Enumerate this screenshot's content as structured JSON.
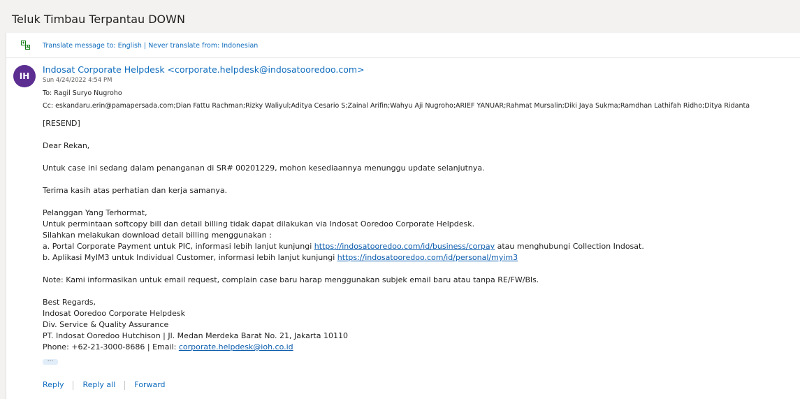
{
  "subject": "Teluk Timbau Terpantau DOWN",
  "translate": {
    "translate_label": "Translate message to: English",
    "separator": " | ",
    "never_label": "Never translate from: Indonesian"
  },
  "message": {
    "avatar_initials": "IH",
    "avatar_color": "#5c2e91",
    "sender": "Indosat Corporate Helpdesk <corporate.helpdesk@indosatooredoo.com>",
    "datetime": "Sun 4/24/2022 4:54 PM",
    "to_line": "To:  Ragil Suryo Nugroho",
    "cc_line": "Cc:  eskandaru.erin@pamapersada.com;Dian Fattu Rachman;Rizky Waliyul;Aditya Cesario S;Zainal Arifin;Wahyu Aji Nugroho;ARIEF YANUAR;Rahmat Mursalin;Diki Jaya Sukma;Ramdhan Lathifah Ridho;Ditya Ridanta"
  },
  "body": {
    "resend": "[RESEND]",
    "greeting": "Dear Rekan,",
    "case_line": "Untuk case ini sedang dalam penanganan di SR# 00201229, mohon kesediaannya menunggu update selanjutnya.",
    "thanks": "Terima kasih atas perhatian dan kerja samanya.",
    "p1": "Pelanggan Yang Terhormat,",
    "p2": "Untuk permintaan softcopy bill dan detail billing tidak dapat dilakukan via Indosat Ooredoo Corporate Helpdesk.",
    "p3": "Silahkan melakukan download detail billing menggunakan :",
    "a_prefix": "a. Portal Corporate Payment untuk PIC, informasi lebih lanjut kunjungi ",
    "a_link": "https://indosatooredoo.com/id/business/corpay",
    "a_suffix": " atau menghubungi Collection Indosat.",
    "b_prefix": "b. Aplikasi MyIM3 untuk Individual Customer, informasi lebih lanjut kunjungi ",
    "b_link": "https://indosatooredoo.com/id/personal/myim3",
    "note": "Note: Kami informasikan untuk email request, complain case baru harap menggunakan subjek email baru atau tanpa RE/FW/Bls.",
    "sig1": "Best Regards,",
    "sig2": "Indosat Ooredoo Corporate Helpdesk",
    "sig3": "Div. Service & Quality Assurance",
    "sig4": "PT. Indosat Ooredoo Hutchison | Jl. Medan Merdeka Barat No. 21, Jakarta 10110",
    "phone_prefix": "Phone: +62-21-3000-8686 | Email: ",
    "email_link": "corporate.helpdesk@ioh.co.id",
    "ellipsis": "···"
  },
  "actions": {
    "reply": "Reply",
    "reply_all": "Reply all",
    "forward": "Forward"
  }
}
